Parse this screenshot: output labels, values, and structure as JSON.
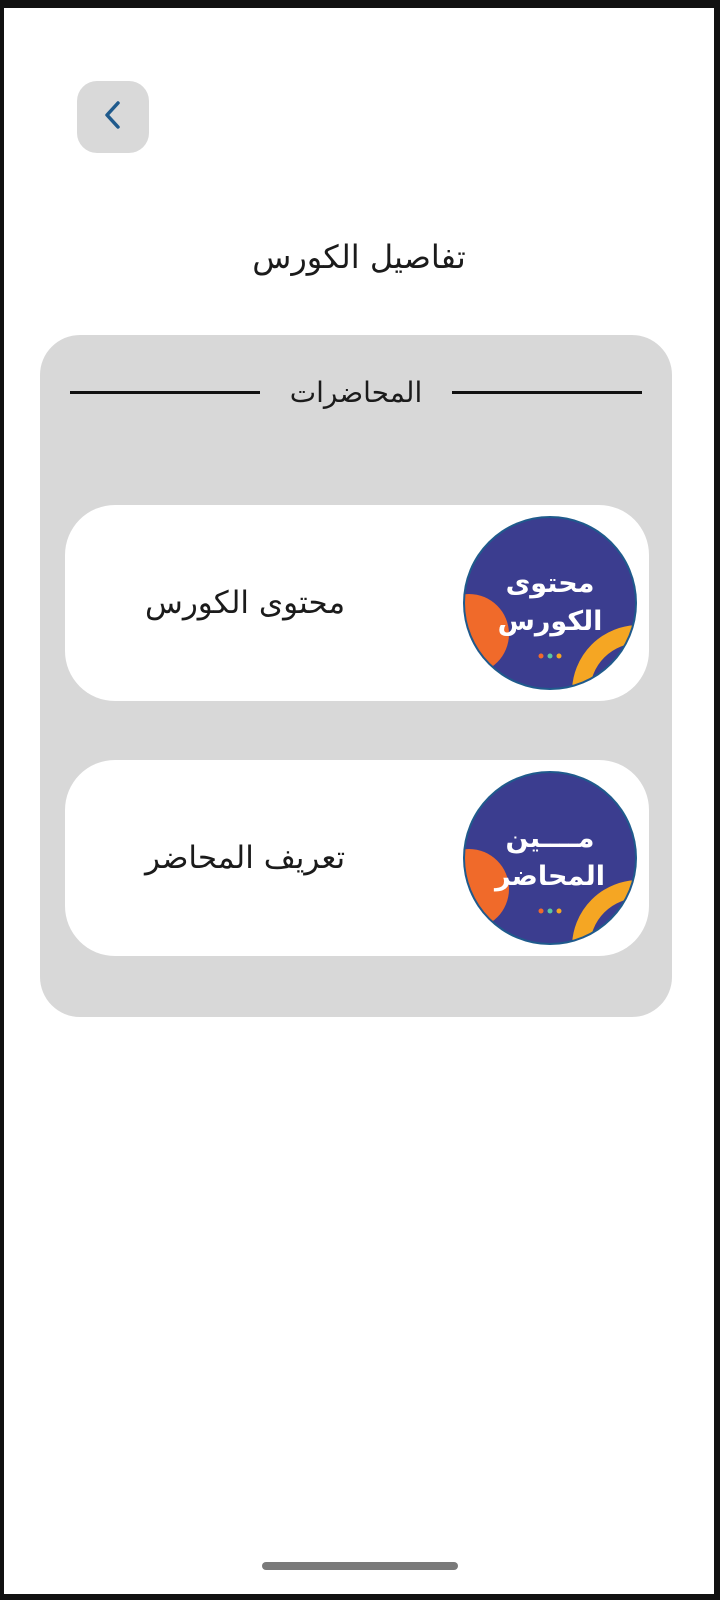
{
  "header": {
    "back_icon": "chevron-left-icon",
    "title": "تفاصيل الكورس"
  },
  "section": {
    "label": "المحاضرات"
  },
  "cards": [
    {
      "title": "محتوى الكورس",
      "thumb_line1": "محتوى",
      "thumb_line2": "الكورس"
    },
    {
      "title": "تعريف المحاضر",
      "thumb_line1": "مــــين",
      "thumb_line2": "المحاضر"
    }
  ],
  "colors": {
    "accent": "#1f5a8c",
    "thumb_bg": "#3b3d8f",
    "thumb_orange": "#f06a2a",
    "thumb_yellow": "#f5a623",
    "panel_bg": "#d8d8d8"
  }
}
